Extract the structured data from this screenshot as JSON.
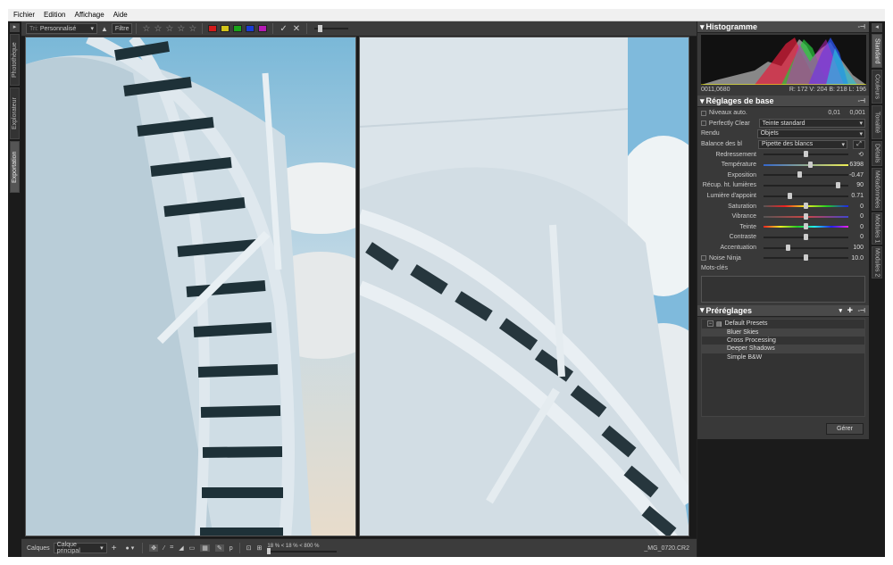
{
  "menu": {
    "items": [
      "Fichier",
      "Edition",
      "Affichage",
      "Aide"
    ]
  },
  "left_tabs": [
    "Photothèque",
    "Explorateur",
    "Exportation"
  ],
  "toolbar": {
    "filter_prefix": "Tri:",
    "filter_value": "Personnalisé",
    "filter_button": "Filtre",
    "stars": [
      "☆",
      "☆",
      "☆",
      "☆",
      "☆"
    ],
    "color_labels": [
      "#d21a1a",
      "#d2c41a",
      "#1aa51a",
      "#1a3cd2",
      "#b41ab4"
    ],
    "accept_icon": "✓",
    "reject_icon": "✕"
  },
  "bottombar": {
    "layers_label": "Calques",
    "layer_value": "Calque principal",
    "zoom_text": "18 % < 18 % < 800 %",
    "filename": "_MG_0720.CR2",
    "p_label": "p"
  },
  "histogram": {
    "title": "Histogramme",
    "coords": "0011,0680",
    "rgb": "R: 172 V: 204 B: 218 L: 196"
  },
  "basic": {
    "title": "Réglages de base",
    "auto_levels_label": "Niveaux auto.",
    "auto_levels_v1": "0,01",
    "auto_levels_v2": "0,001",
    "perfectly_clear_label": "Perfectly Clear",
    "perfectly_clear_value": "Teinte standard",
    "render_label": "Rendu",
    "render_value": "Objets",
    "wb_label": "Balance des bl",
    "wb_value": "Pipette des blancs",
    "sliders": [
      {
        "label": "Redressement",
        "value": "",
        "pos": 0.5
      },
      {
        "label": "Température",
        "value": "6398",
        "pos": 0.55
      },
      {
        "label": "Exposition",
        "value": "-0.47",
        "pos": 0.42
      },
      {
        "label": "Récup. ht. lumières",
        "value": "90",
        "pos": 0.9
      },
      {
        "label": "Lumière d'appoint",
        "value": "0.71",
        "pos": 0.3
      },
      {
        "label": "Saturation",
        "value": "0",
        "pos": 0.5
      },
      {
        "label": "Vibrance",
        "value": "0",
        "pos": 0.5
      },
      {
        "label": "Teinte",
        "value": "0",
        "pos": 0.5
      },
      {
        "label": "Contraste",
        "value": "0",
        "pos": 0.5
      },
      {
        "label": "Accentuation",
        "value": "100",
        "pos": 0.28
      }
    ],
    "noise_label": "Noise Ninja",
    "noise_value": "10.0",
    "keywords_label": "Mots-clés"
  },
  "presets": {
    "title": "Préréglages",
    "folder": "Default Presets",
    "items": [
      "Bluer Skies",
      "Cross Processing",
      "Deeper Shadows",
      "Simple B&W"
    ],
    "manage_button": "Gérer"
  },
  "right_tabs": [
    "Standard",
    "Couleurs",
    "Tonalité",
    "Détails",
    "Métadonnées",
    "Modules 1",
    "Modules 2"
  ]
}
